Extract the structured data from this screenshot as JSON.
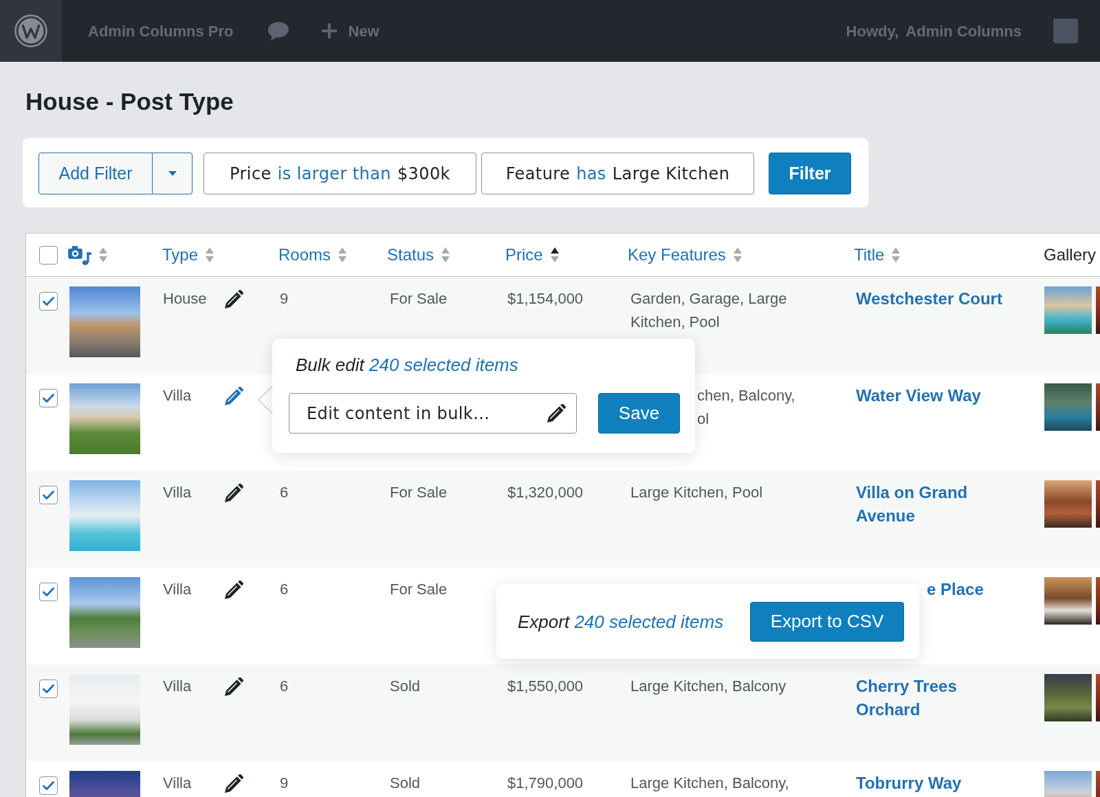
{
  "top_bar": {
    "site_name": "Admin Columns Pro",
    "new_label": "New",
    "greeting": "Howdy,",
    "user_name": "Admin Columns"
  },
  "page_title": "House - Post Type",
  "filter_bar": {
    "add_filter_label": "Add Filter",
    "filters": [
      {
        "field": "Price",
        "operator": "is larger than",
        "value": "$300k"
      },
      {
        "field": "Feature",
        "operator": "has",
        "value": "Large Kitchen"
      }
    ],
    "button_label": "Filter"
  },
  "table": {
    "select_all": {
      "checked": false
    },
    "columns": [
      {
        "kind": "icon",
        "sortable": true,
        "sorted_ascending": false
      },
      {
        "kind": "text",
        "label": "Type",
        "sortable": true,
        "sorted_ascending": false
      },
      {
        "kind": "text",
        "label": "Rooms",
        "sortable": true,
        "sorted_ascending": false
      },
      {
        "kind": "text",
        "label": "Status",
        "sortable": true,
        "sorted_ascending": false
      },
      {
        "kind": "text",
        "label": "Price",
        "sortable": true,
        "sorted_ascending": true
      },
      {
        "kind": "text",
        "label": "Key Features",
        "sortable": true,
        "sorted_ascending": false
      },
      {
        "kind": "text",
        "label": "Title",
        "sortable": true,
        "sorted_ascending": false
      },
      {
        "kind": "text",
        "label": "Gallery",
        "sortable": false
      }
    ],
    "rows": [
      {
        "checked": true,
        "type": "House",
        "edit_active": false,
        "rooms": "9",
        "status": "For Sale",
        "price": "$1,154,000",
        "key_features": "Garden, Garage, Large Kitchen, Pool",
        "title": "Westchester Court"
      },
      {
        "checked": true,
        "type": "Villa",
        "edit_active": true,
        "key_features_fragments": [
          "chen, Balcony,",
          "ol"
        ],
        "title": "Water View Way"
      },
      {
        "checked": true,
        "type": "Villa",
        "edit_active": false,
        "rooms": "6",
        "status": "For Sale",
        "price": "$1,320,000",
        "key_features": "Large Kitchen, Pool",
        "title": "Villa on Grand Avenue"
      },
      {
        "checked": true,
        "type": "Villa",
        "edit_active": false,
        "rooms": "6",
        "status": "For Sale",
        "title_fragment": "e Place"
      },
      {
        "checked": true,
        "type": "Villa",
        "edit_active": false,
        "rooms": "6",
        "status": "Sold",
        "price": "$1,550,000",
        "key_features": "Large Kitchen, Balcony",
        "title": "Cherry Trees Orchard"
      },
      {
        "checked": true,
        "type": "Villa",
        "edit_active": false,
        "rooms": "9",
        "status": "Sold",
        "price": "$1,790,000",
        "key_features": "Large Kitchen, Balcony,",
        "title": "Tobrurry Way"
      }
    ]
  },
  "bulk_edit_popover": {
    "label": "Bulk edit",
    "link": "240 selected items",
    "placeholder": "Edit content in bulk...",
    "save_label": "Save"
  },
  "export_popover": {
    "label": "Export",
    "link": "240 selected items",
    "button_label": "Export to CSV"
  }
}
